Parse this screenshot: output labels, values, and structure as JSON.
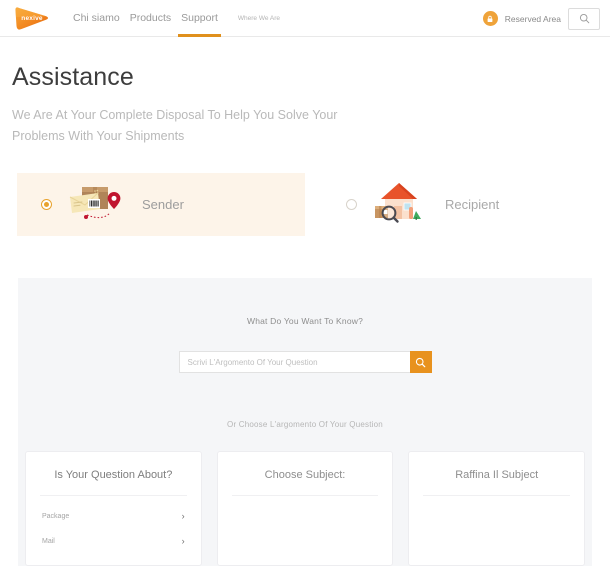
{
  "header": {
    "logo_text": "nexive",
    "logo_name": "nexive-logo",
    "nav": [
      {
        "label": "Chi siamo",
        "active": false
      },
      {
        "label": "Products",
        "active": false
      },
      {
        "label": "Support",
        "active": true
      }
    ],
    "nav_small": "Where We Are",
    "reserved_area_label": "Reserved Area",
    "lock_icon": "lock-icon",
    "search_icon": "search-icon"
  },
  "hero": {
    "title": "Assistance",
    "subtitle": "We Are At Your Complete Disposal To Help You Solve Your Problems With Your Shipments"
  },
  "roles": [
    {
      "label": "Sender",
      "selected": true,
      "illustration": "package-with-location-pin-illustration"
    },
    {
      "label": "Recipient",
      "selected": false,
      "illustration": "house-with-magnifier-illustration"
    }
  ],
  "panel": {
    "question": "What Do You Want To Know?",
    "search_placeholder": "Scrivi L'Argomento Of Your Question",
    "search_value": "",
    "search_button_icon": "search-icon",
    "or_choose": "Or Choose L'argomento Of Your Question"
  },
  "cards": [
    {
      "title": "Is Your Question About?",
      "items": [
        {
          "label": "Package",
          "chevron": "›"
        },
        {
          "label": "Mail",
          "chevron": "›"
        }
      ]
    },
    {
      "title": "Choose Subject:",
      "items": []
    },
    {
      "title": "Raffina Il Subject",
      "items": []
    }
  ],
  "colors": {
    "accent_orange": "#e8921e",
    "logo_orange": "#f2871f",
    "panel_grey": "#f5f6f8",
    "sender_bg": "#fdf4e9",
    "pin_red": "#c0152f"
  }
}
